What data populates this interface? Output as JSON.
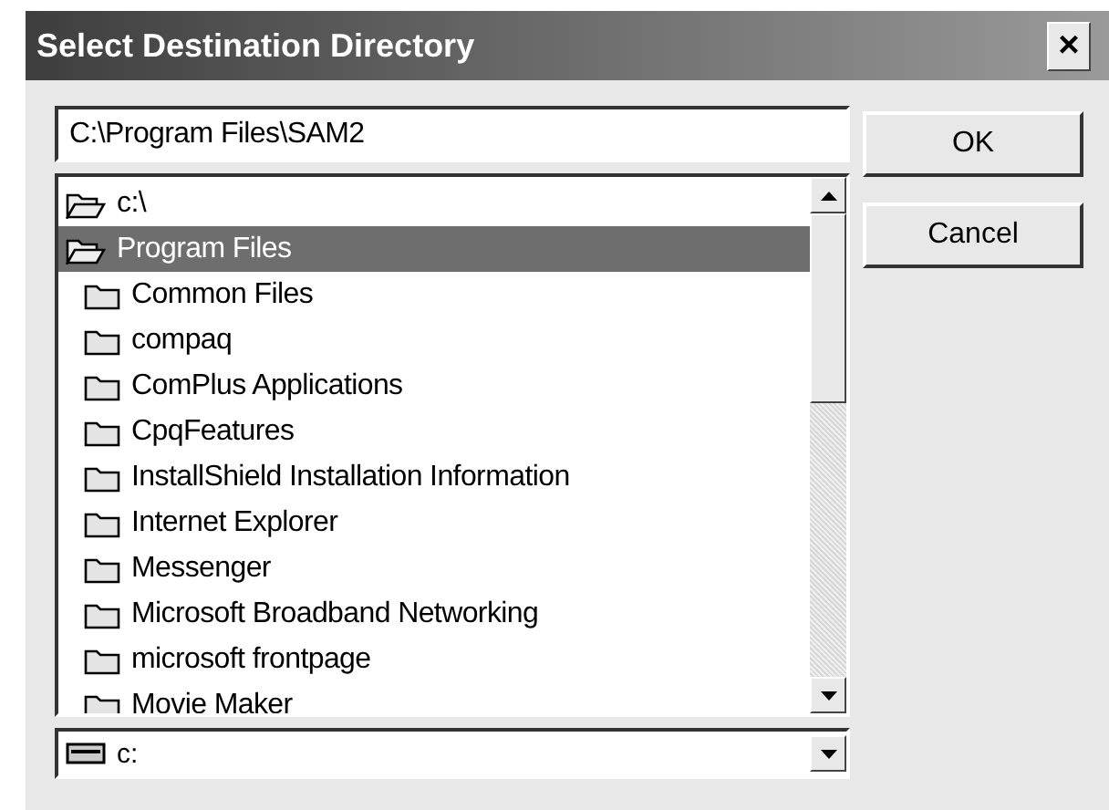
{
  "window": {
    "title": "Select Destination Directory",
    "close": "×"
  },
  "path_field": {
    "value": "C:\\Program Files\\SAM2"
  },
  "tree": [
    {
      "label": "c:\\",
      "expanded": true,
      "selected": false,
      "children": [
        {
          "label": "Program Files",
          "expanded": true,
          "selected": true,
          "children": [
            {
              "label": "Common Files",
              "expanded": false,
              "selected": false
            },
            {
              "label": "compaq",
              "expanded": false,
              "selected": false
            },
            {
              "label": "ComPlus Applications",
              "expanded": false,
              "selected": false
            },
            {
              "label": "CpqFeatures",
              "expanded": false,
              "selected": false
            },
            {
              "label": "InstallShield Installation Information",
              "expanded": false,
              "selected": false
            },
            {
              "label": "Internet Explorer",
              "expanded": false,
              "selected": false
            },
            {
              "label": "Messenger",
              "expanded": false,
              "selected": false
            },
            {
              "label": "Microsoft Broadband Networking",
              "expanded": false,
              "selected": false
            },
            {
              "label": "microsoft frontpage",
              "expanded": false,
              "selected": false
            },
            {
              "label": "Movie Maker",
              "expanded": false,
              "selected": false
            }
          ]
        }
      ]
    }
  ],
  "drive": {
    "value": "c:"
  },
  "buttons": [
    "OK",
    "Cancel"
  ]
}
